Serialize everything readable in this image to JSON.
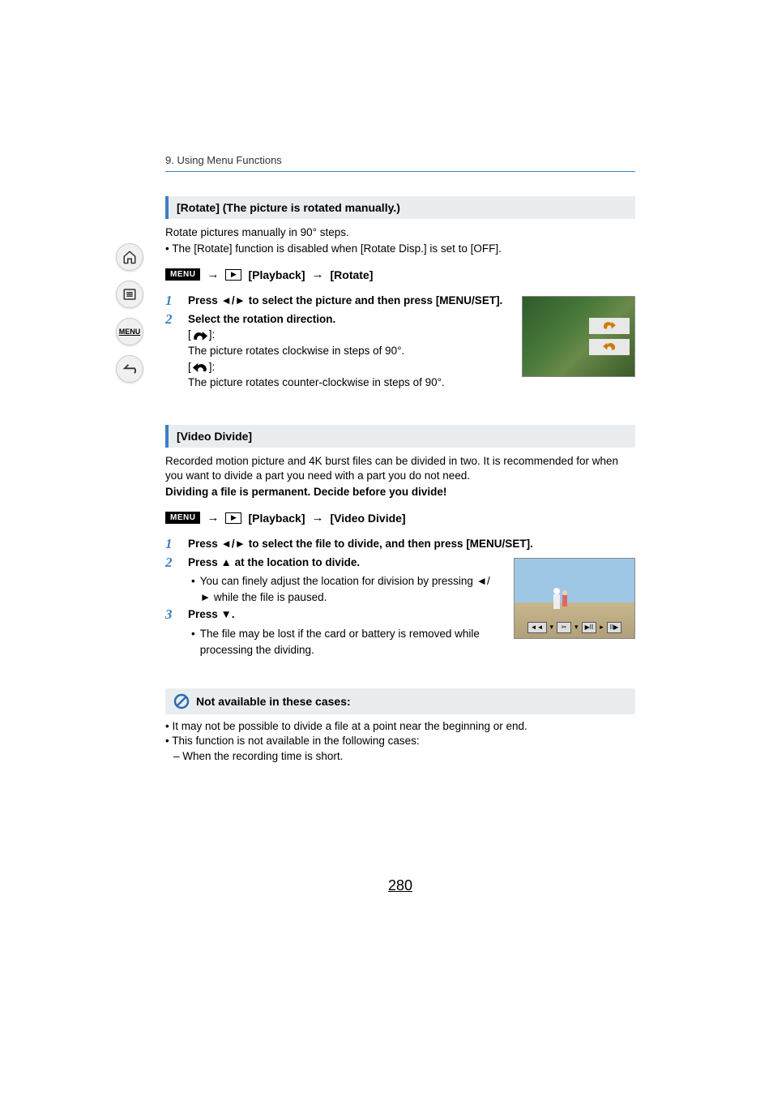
{
  "breadcrumb": "9. Using Menu Functions",
  "sidebar": {
    "home": "home-icon",
    "list": "list-icon",
    "menu": "MENU",
    "back": "back-icon"
  },
  "rotate": {
    "header": "[Rotate] (The picture is rotated manually.)",
    "intro": "Rotate pictures manually in 90° steps.",
    "note": "• The [Rotate] function is disabled when [Rotate Disp.] is set to [OFF].",
    "path_playback": "[Playback]",
    "path_target": "[Rotate]",
    "step1": "Press ◄/► to select the picture and then press [MENU/SET].",
    "step2_title": "Select the rotation direction.",
    "step2_cw_bracket_open": "[",
    "step2_cw_bracket_close": "]:",
    "step2_cw_desc": "The picture rotates clockwise in steps of 90°.",
    "step2_ccw_bracket_open": "[",
    "step2_ccw_bracket_close": "]:",
    "step2_ccw_desc": "The picture rotates counter-clockwise in steps of 90°."
  },
  "divide": {
    "header": "[Video Divide]",
    "intro": "Recorded motion picture and 4K burst files can be divided in two. It is recommended for when you want to divide a part you need with a part you do not need.",
    "warning": "Dividing a file is permanent. Decide before you divide!",
    "path_playback": "[Playback]",
    "path_target": "[Video Divide]",
    "step1": "Press ◄/► to select the file to divide, and then press [MENU/SET].",
    "step2_title": "Press ▲ at the location to divide.",
    "step2_sub": "You can finely adjust the location for division by pressing ◄/► while the file is paused.",
    "step3_title": "Press ▼.",
    "step3_sub": "The file may be lost if the card or battery is removed while processing the dividing."
  },
  "not_available": {
    "header": "Not available in these cases:",
    "b1": "• It may not be possible to divide a file at a point near the beginning or end.",
    "b2": "• This function is not available in the following cases:",
    "b2a": "– When the recording time is short."
  },
  "menu_badge": "MENU",
  "arrow": "→",
  "page_number": "280"
}
